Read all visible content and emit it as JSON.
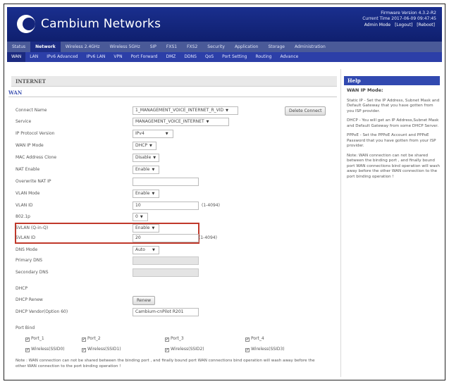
{
  "header": {
    "brand": "Cambium Networks",
    "firmware": "Firmware Version 4.3.2-R2",
    "current_time": "Current Time 2017-06-09 09:47:45",
    "mode": "Admin Mode",
    "logout": "[Logout]",
    "reboot": "[Reboot]"
  },
  "nav_main": [
    "Status",
    "Network",
    "Wireless 2.4GHz",
    "Wireless 5GHz",
    "SIP",
    "FXS1",
    "FXS2",
    "Security",
    "Application",
    "Storage",
    "Administration"
  ],
  "nav_sub": [
    "WAN",
    "LAN",
    "IPv6 Advanced",
    "IPv6 LAN",
    "VPN",
    "Port Forward",
    "DMZ",
    "DDNS",
    "QoS",
    "Port Setting",
    "Routing",
    "Advance"
  ],
  "section": {
    "title": "INTERNET",
    "subtitle": "WAN"
  },
  "form": {
    "connect_name": {
      "label": "Connect Name",
      "value": "1_MANAGEMENT_VOICE_INTERNET_R_VID"
    },
    "delete_button": "Delete Connect",
    "service": {
      "label": "Service",
      "value": "MANAGEMENT_VOICE_INTERNET"
    },
    "ip_protocol": {
      "label": "IP Protocol Version",
      "value": "IPv4"
    },
    "wan_ip_mode": {
      "label": "WAN IP Mode",
      "value": "DHCP"
    },
    "mac_clone": {
      "label": "MAC Address Clone",
      "value": "Disable"
    },
    "nat_enable": {
      "label": "NAT Enable",
      "value": "Enable"
    },
    "override_nat": {
      "label": "Overwrite NAT IP",
      "value": ""
    },
    "vlan_mode": {
      "label": "VLAN Mode",
      "value": "Enable"
    },
    "vlan_id": {
      "label": "VLAN ID",
      "value": "10",
      "hint": "(1-4094)"
    },
    "p8021": {
      "label": "802.1p",
      "value": "0"
    },
    "svlan_qinq": {
      "label": "SVLAN (Q-in-Q)",
      "value": "Enable"
    },
    "svlan_id": {
      "label": "SVLAN ID",
      "value": "20",
      "hint": "(1-4094)"
    },
    "dns_mode": {
      "label": "DNS Mode",
      "value": "Auto"
    },
    "primary_dns": {
      "label": "Primary DNS",
      "value": ""
    },
    "secondary_dns": {
      "label": "Secondary DNS",
      "value": ""
    },
    "dhcp_heading": "DHCP",
    "dhcp_renew": {
      "label": "DHCP Renew",
      "button": "Renew"
    },
    "dhcp_vendor": {
      "label": "DHCP Vendor(Option 60)",
      "value": "Cambium-cnPilot R201"
    },
    "port_bind_heading": "Port Bind",
    "ports": [
      "Port_1",
      "Port_2",
      "Port_3",
      "Port_4"
    ],
    "ssids": [
      "Wireless(SSID0)",
      "Wireless(SSID1)",
      "Wireless(SSID2)",
      "Wireless(SSID3)"
    ],
    "note": "Note : WAN connection can not be shared between the binding port , and finally bound port WAN connections bind operation will wash away before the other WAN connection to the port binding operation !"
  },
  "help": {
    "title": "Help",
    "heading": "WAN IP Mode:",
    "static": "Static IP - Set the IP Address, Subnet Mask and Default Gateway that you have gotten from you ISP provider.",
    "dhcp": "DHCP - You will get an IP Address,Subnet Mask and Default Gateway from some DHCP Server.",
    "pppoe": "PPPoE - Set the PPPoE Account and PPPoE Password that you have gotten from your ISP provider.",
    "note": "Note: WAN connection can not be shared between the binding port , and finally bound port WAN connections bind operation will wash away before the other WAN connection to the port binding operation !"
  },
  "colors": {
    "header": "#13247a",
    "nav_main": "#4a5a98",
    "nav_sub": "#2c3fa8",
    "highlight": "#c0392b"
  }
}
